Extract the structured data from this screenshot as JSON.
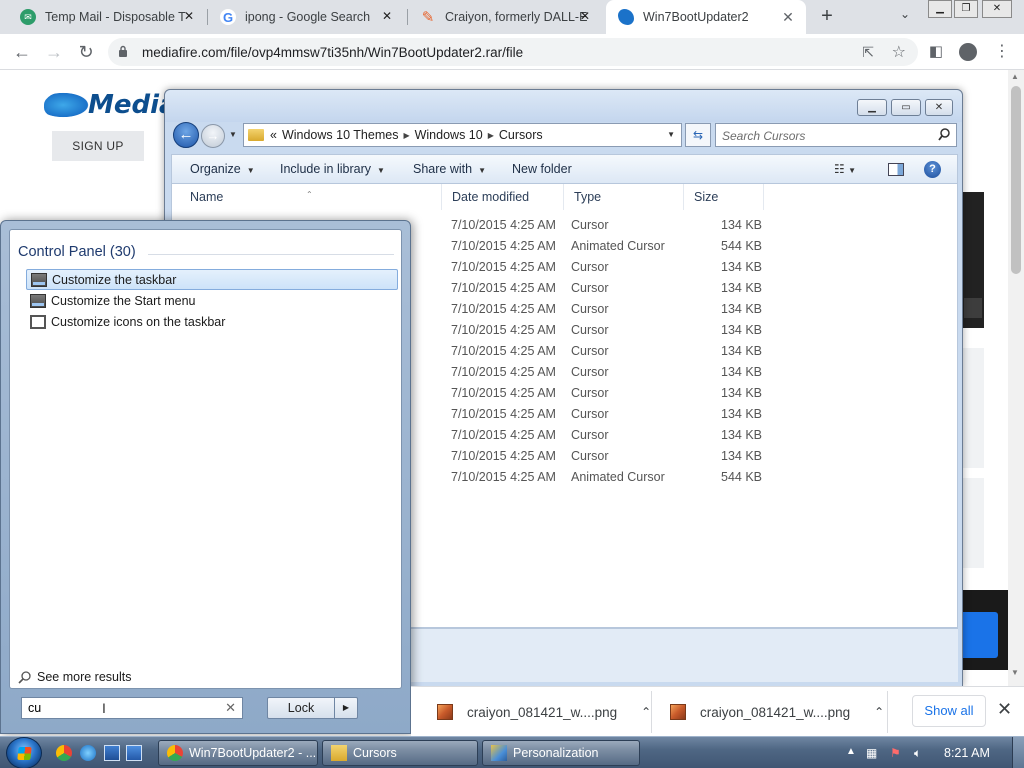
{
  "browser": {
    "tabs": [
      {
        "title": "Temp Mail - Disposable T",
        "favicon": "tempmail-icon",
        "color": "#2d9c6a"
      },
      {
        "title": "ipong - Google Search",
        "favicon": "google-icon",
        "color": "#4285f4"
      },
      {
        "title": "Craiyon, formerly DALL-E",
        "favicon": "pencil-icon",
        "color": "#e8622a"
      },
      {
        "title": "Win7BootUpdater2",
        "favicon": "mediafire-icon",
        "color": "#1b72c9"
      }
    ],
    "url": "mediafire.com/file/ovp4mmsw7ti35nh/Win7BootUpdater2.rar/file"
  },
  "mediafire": {
    "logo_text": "Media",
    "signup_label": "SIGN UP"
  },
  "explorer": {
    "breadcrumb": [
      "Windows 10 Themes",
      "Windows 10",
      "Cursors"
    ],
    "search_placeholder": "Search Cursors",
    "commands": [
      "Organize",
      "Include in library",
      "Share with",
      "New folder"
    ],
    "columns": [
      "Name",
      "Date modified",
      "Type",
      "Size"
    ],
    "files": [
      {
        "date": "7/10/2015 4:25 AM",
        "type": "Cursor",
        "size": "134 KB"
      },
      {
        "date": "7/10/2015 4:25 AM",
        "type": "Animated Cursor",
        "size": "544 KB"
      },
      {
        "date": "7/10/2015 4:25 AM",
        "type": "Cursor",
        "size": "134 KB"
      },
      {
        "date": "7/10/2015 4:25 AM",
        "type": "Cursor",
        "size": "134 KB"
      },
      {
        "date": "7/10/2015 4:25 AM",
        "type": "Cursor",
        "size": "134 KB"
      },
      {
        "date": "7/10/2015 4:25 AM",
        "type": "Cursor",
        "size": "134 KB"
      },
      {
        "date": "7/10/2015 4:25 AM",
        "type": "Cursor",
        "size": "134 KB"
      },
      {
        "date": "7/10/2015 4:25 AM",
        "type": "Cursor",
        "size": "134 KB"
      },
      {
        "date": "7/10/2015 4:25 AM",
        "type": "Cursor",
        "size": "134 KB"
      },
      {
        "date": "7/10/2015 4:25 AM",
        "type": "Cursor",
        "size": "134 KB"
      },
      {
        "date": "7/10/2015 4:25 AM",
        "type": "Cursor",
        "size": "134 KB"
      },
      {
        "date": "7/10/2015 4:25 AM",
        "type": "Cursor",
        "size": "134 KB"
      },
      {
        "date": "7/10/2015 4:25 AM",
        "type": "Animated Cursor",
        "size": "544 KB"
      }
    ]
  },
  "start_menu": {
    "group_header": "Control Panel (30)",
    "results": [
      "Customize the taskbar",
      "Customize the Start menu",
      "Customize icons on the taskbar"
    ],
    "see_more": "See more results",
    "search_value": "cu",
    "lock_label": "Lock"
  },
  "downloads": {
    "items": [
      "craiyon_081421_w....png",
      "craiyon_081421_w....png"
    ],
    "show_all": "Show all"
  },
  "taskbar": {
    "buttons": [
      "Win7BootUpdater2 - ...",
      "Cursors",
      "Personalization"
    ],
    "clock": "8:21 AM"
  }
}
